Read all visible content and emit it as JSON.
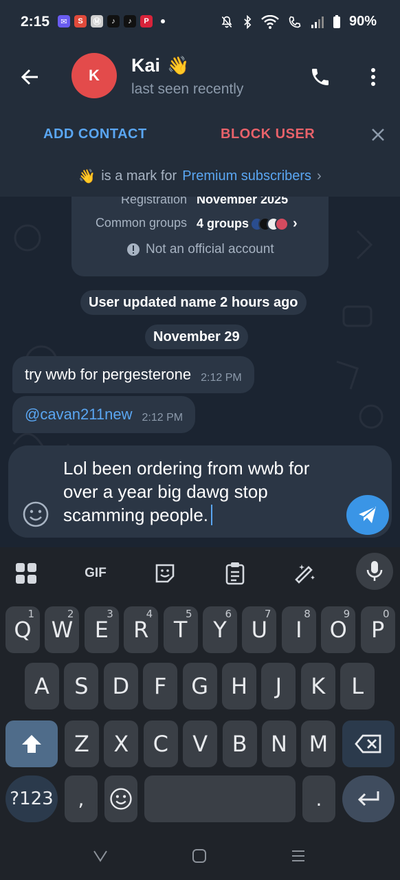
{
  "status_bar": {
    "time": "2:15",
    "battery": "90%",
    "app_icons": [
      {
        "name": "messenger-icon",
        "glyph": "✉",
        "color": "#6a5cf0"
      },
      {
        "name": "shopping-icon",
        "glyph": "S",
        "color": "#e04a3b"
      },
      {
        "name": "news-icon",
        "glyph": "Ⓜ",
        "color": "#cfcfcf"
      },
      {
        "name": "tiktok-icon",
        "glyph": "♪",
        "color": "#111111"
      },
      {
        "name": "tiktok-icon-2",
        "glyph": "♪",
        "color": "#111111"
      },
      {
        "name": "pinterest-icon",
        "glyph": "P",
        "color": "#d8233a"
      }
    ]
  },
  "header": {
    "avatar_initial": "K",
    "name": "Kai",
    "status": "last seen recently",
    "emoji": "👋"
  },
  "actions": {
    "add_contact": "ADD CONTACT",
    "block_user": "BLOCK USER"
  },
  "premium_bar": {
    "prefix": "is a mark for",
    "link": "Premium subscribers",
    "chevron": "›"
  },
  "info_card": {
    "registration_label": "Registration",
    "registration_value": "November 2025",
    "groups_label": "Common groups",
    "groups_value": "4 groups",
    "not_official": "Not an official account"
  },
  "service_messages": {
    "name_update": "User updated name 2 hours ago",
    "date": "November 29"
  },
  "messages": [
    {
      "text": "try wwb for pergesterone",
      "time": "2:12 PM"
    },
    {
      "text": "@cavan211new",
      "time": "2:12 PM"
    }
  ],
  "composer": {
    "text": "Lol been ordering from wwb for over a year big dawg stop scamming people."
  },
  "keyboard": {
    "toolbar": {
      "gif": "GIF"
    },
    "row1": [
      {
        "k": "Q",
        "h": "1"
      },
      {
        "k": "W",
        "h": "2"
      },
      {
        "k": "E",
        "h": "3"
      },
      {
        "k": "R",
        "h": "4"
      },
      {
        "k": "T",
        "h": "5"
      },
      {
        "k": "Y",
        "h": "6"
      },
      {
        "k": "U",
        "h": "7"
      },
      {
        "k": "I",
        "h": "8"
      },
      {
        "k": "O",
        "h": "9"
      },
      {
        "k": "P",
        "h": "0"
      }
    ],
    "row2": [
      "A",
      "S",
      "D",
      "F",
      "G",
      "H",
      "J",
      "K",
      "L"
    ],
    "row3": [
      "Z",
      "X",
      "C",
      "V",
      "B",
      "N",
      "M"
    ],
    "symbols": "?123",
    "comma": ",",
    "period": "."
  },
  "colors": {
    "accent": "#5aa6f2",
    "danger": "#e8626a",
    "avatar": "#e34b4b",
    "send": "#3a95e6"
  }
}
